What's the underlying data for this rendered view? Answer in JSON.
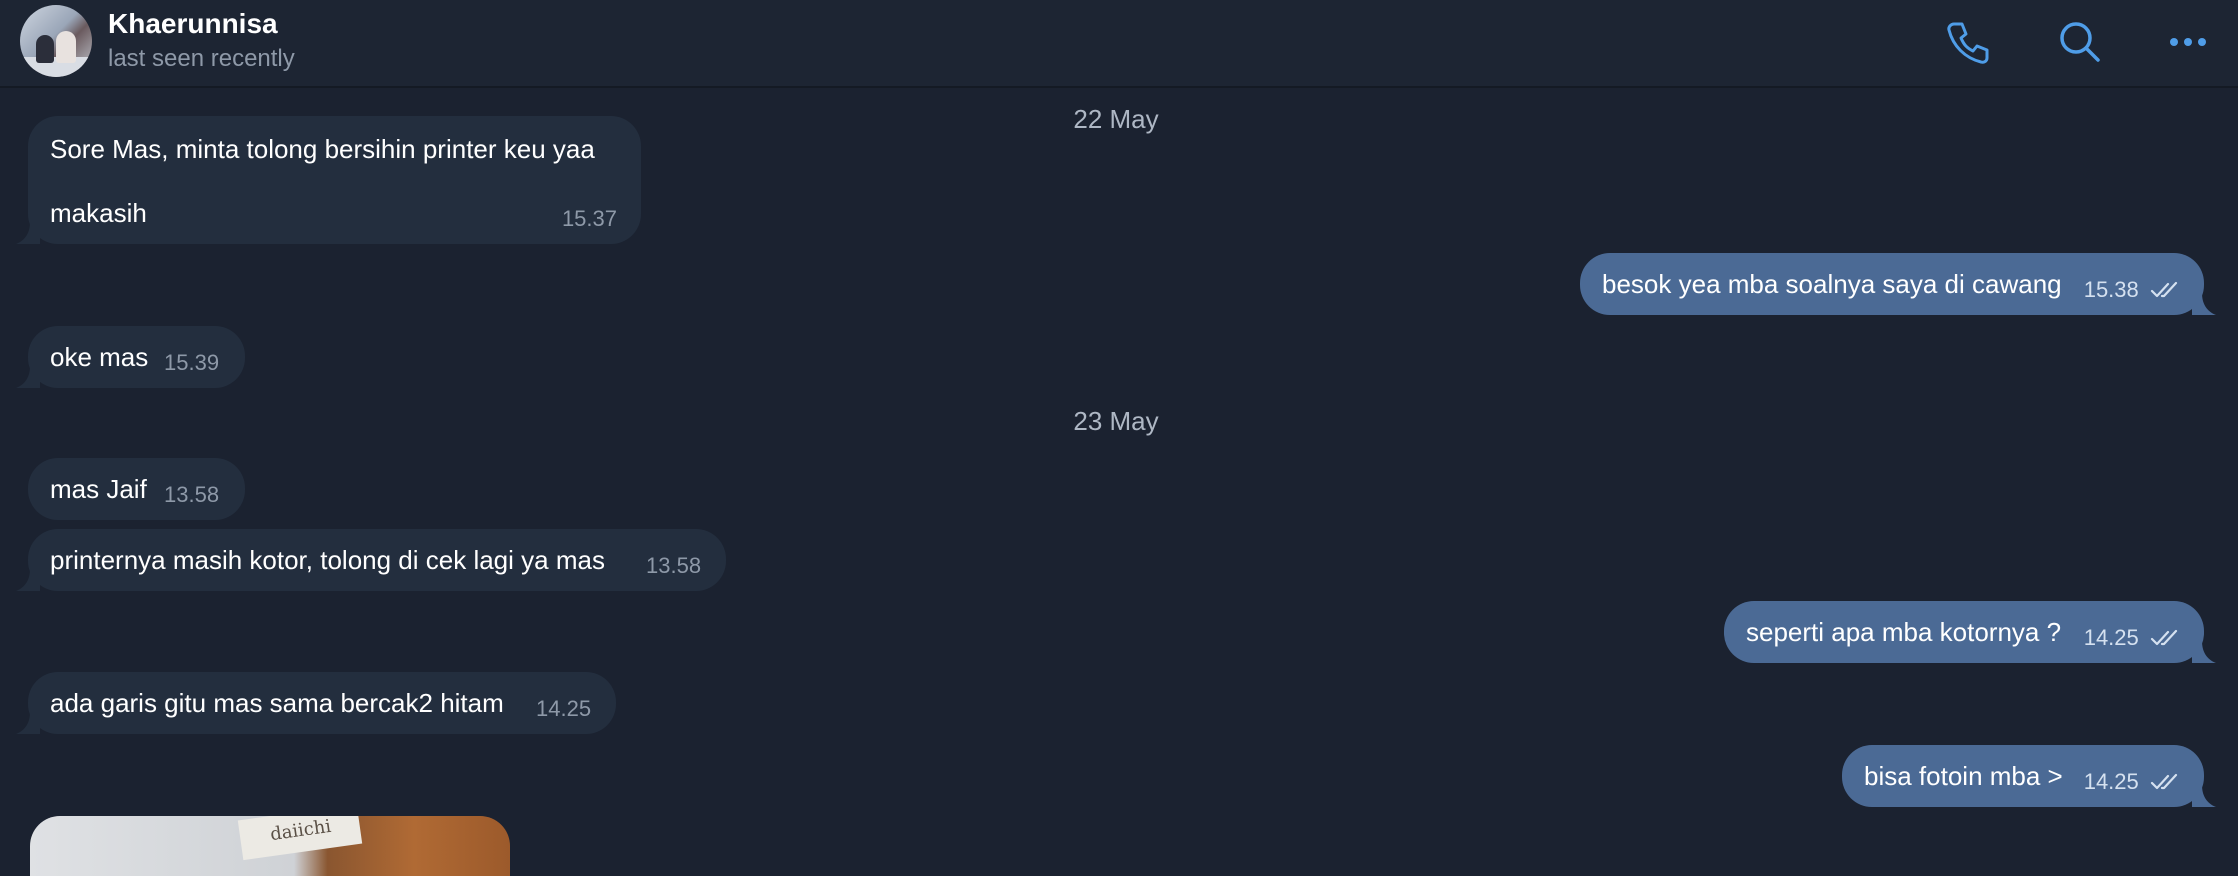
{
  "header": {
    "contact_name": "Khaerunnisa",
    "status": "last seen recently",
    "icons": [
      "phone-icon",
      "search-icon",
      "more-icon"
    ]
  },
  "colors": {
    "background": "#1b2230",
    "incoming_bubble": "#232e3e",
    "outgoing_bubble": "#4b6a95",
    "accent": "#4f9de8"
  },
  "chat": {
    "date1": "22 May",
    "date2": "23 May",
    "messages": [
      {
        "dir": "in",
        "line1": "Sore Mas, minta tolong bersihin printer keu yaa",
        "line2": "makasih",
        "time": "15.37"
      },
      {
        "dir": "out",
        "text": "besok yea mba soalnya saya di cawang",
        "time": "15.38",
        "read": true
      },
      {
        "dir": "in",
        "text": "oke mas",
        "time": "15.39"
      },
      {
        "dir": "in",
        "text": "mas Jaif",
        "time": "13.58"
      },
      {
        "dir": "in",
        "text": "printernya masih kotor, tolong di cek lagi ya mas",
        "time": "13.58"
      },
      {
        "dir": "out",
        "text": "seperti apa mba kotornya ?",
        "time": "14.25",
        "read": true
      },
      {
        "dir": "in",
        "text": "ada garis gitu mas sama bercak2 hitam",
        "time": "14.25"
      },
      {
        "dir": "out",
        "text": "bisa fotoin mba >",
        "time": "14.25",
        "read": true
      }
    ],
    "photo_brand": "daiichi"
  }
}
